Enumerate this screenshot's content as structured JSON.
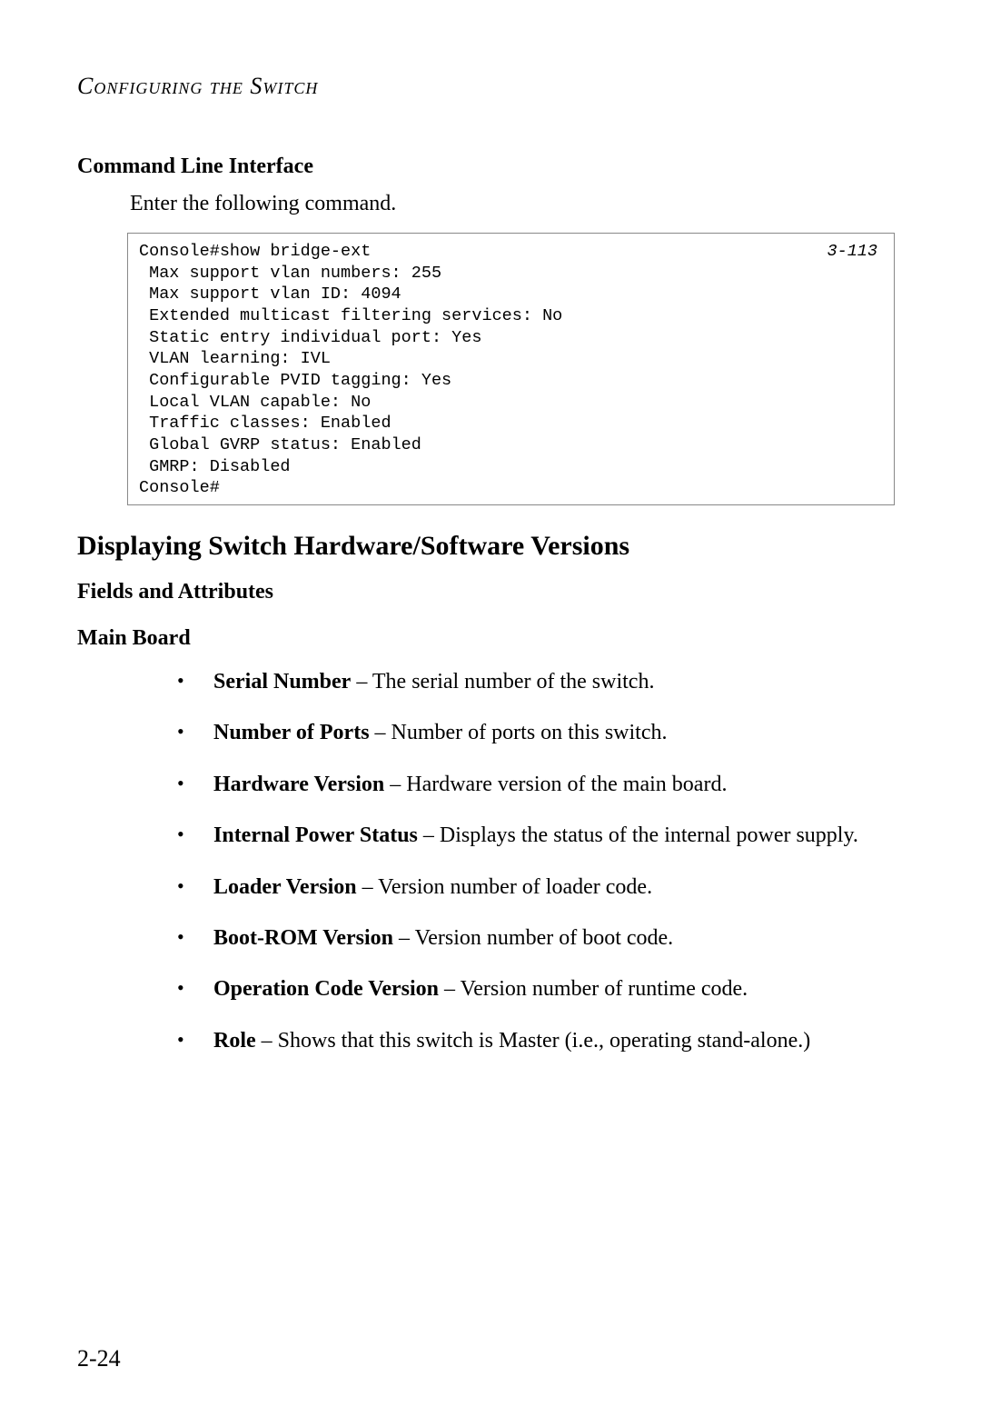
{
  "running_head": "Configuring the Switch",
  "section_cli": "Command Line Interface",
  "intro": "Enter the following command.",
  "code": {
    "ref": "3-113",
    "lines": [
      "Console#show bridge-ext",
      " Max support vlan numbers: 255",
      " Max support vlan ID: 4094",
      " Extended multicast filtering services: No",
      " Static entry individual port: Yes",
      " VLAN learning: IVL",
      " Configurable PVID tagging: Yes",
      " Local VLAN capable: No",
      " Traffic classes: Enabled",
      " Global GVRP status: Enabled",
      " GMRP: Disabled",
      "Console#"
    ]
  },
  "h2": "Displaying Switch Hardware/Software Versions",
  "sub1": "Fields and Attributes",
  "sub2": "Main Board",
  "items": [
    {
      "term": "Serial Number",
      "sep": " – ",
      "desc": "The serial number of the switch."
    },
    {
      "term": "Number of Ports",
      "sep": " – ",
      "desc": "Number of ports on this switch."
    },
    {
      "term": "Hardware Version",
      "sep": " – ",
      "desc": "Hardware version of the main board."
    },
    {
      "term": "Internal Power Status",
      "sep": " – ",
      "desc": "Displays the status of the internal power supply."
    },
    {
      "term": "Loader Version",
      "sep": " – ",
      "desc": "Version number of loader code."
    },
    {
      "term": "Boot-ROM Version",
      "sep": " – ",
      "desc": "Version number of boot code."
    },
    {
      "term": "Operation Code Version",
      "sep": " – ",
      "desc": "Version number of runtime code."
    },
    {
      "term": "Role",
      "sep": " – ",
      "desc": "Shows that this switch is Master (i.e., operating stand-alone.)"
    }
  ],
  "page_number": "2-24"
}
